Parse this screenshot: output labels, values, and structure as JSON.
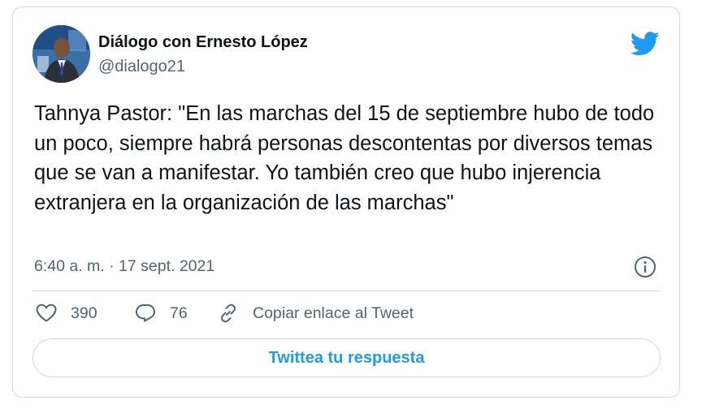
{
  "account": {
    "display_name": "Diálogo con Ernesto López",
    "handle": "@dialogo21",
    "avatar_icon": "profile-photo",
    "brand_icon": "twitter-bird-icon",
    "brand_color": "#1d9bf0"
  },
  "tweet": {
    "text": "Tahnya Pastor: \"En las marchas del 15 de septiembre hubo de todo un poco, siempre habrá personas descontentas por diversos temas que se van a manifestar. Yo también creo que hubo injerencia extranjera en la organización de las marchas\"",
    "timestamp": "6:40 a. m. · 17 sept. 2021"
  },
  "actions": {
    "like_count": "390",
    "reply_count": "76",
    "copy_link_label": "Copiar enlace al Tweet",
    "reply_button_label": "Twittea tu respuesta"
  },
  "colors": {
    "text_primary": "#0f1419",
    "text_secondary": "#536471",
    "border": "#cfd9de",
    "accent": "#1d9bf0"
  }
}
